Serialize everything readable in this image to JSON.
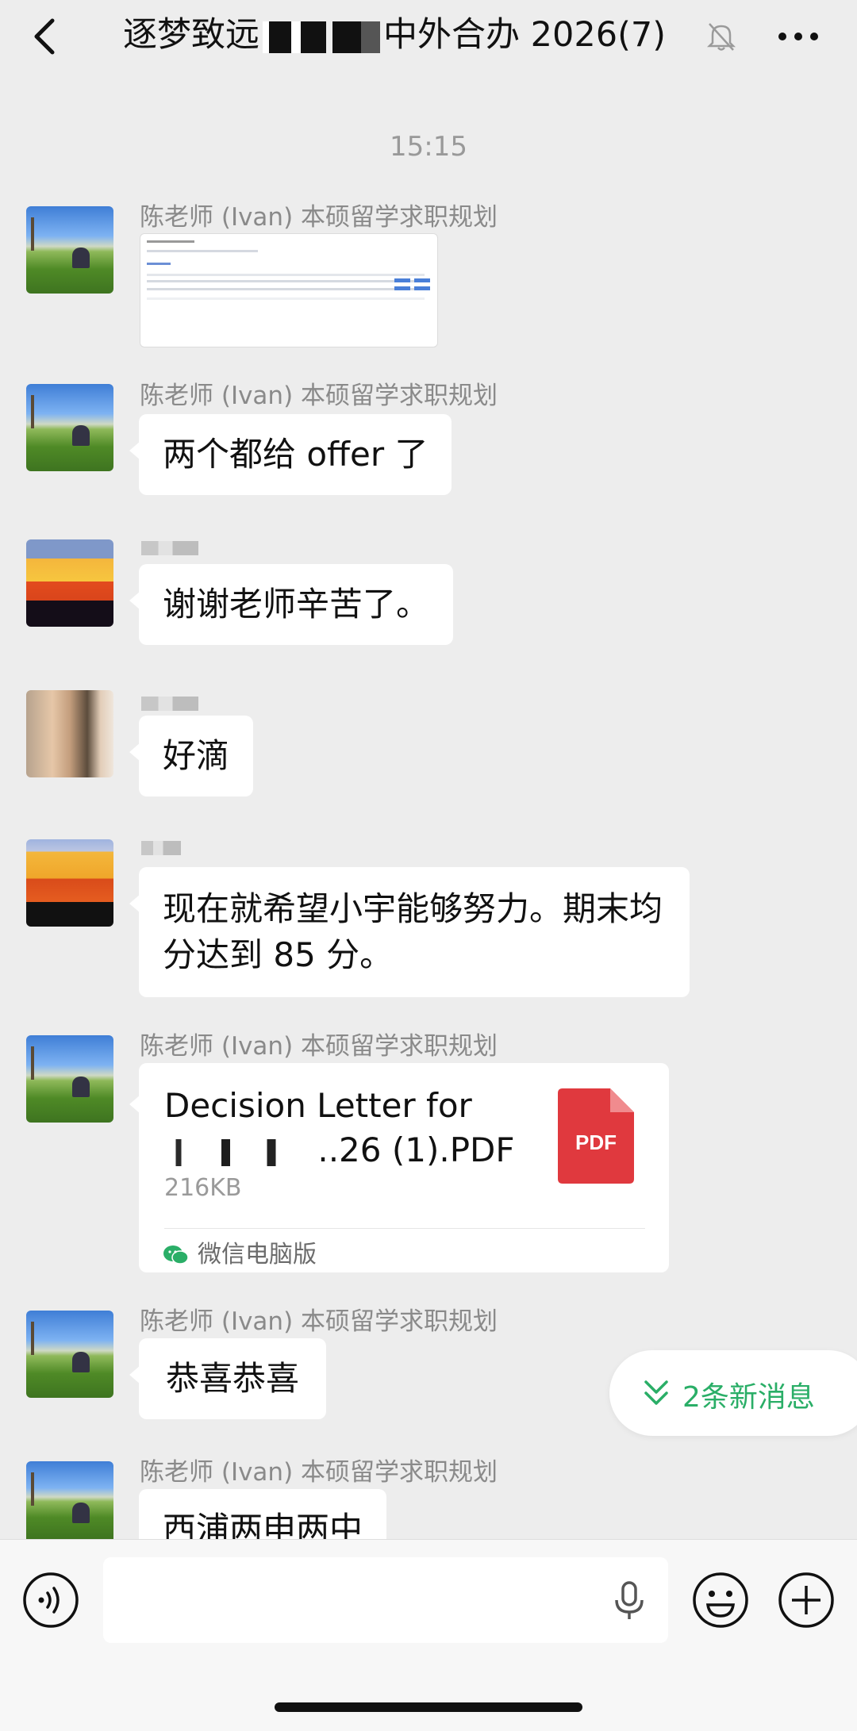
{
  "header": {
    "title_prefix": "逐梦致远",
    "title_suffix": "中外合办 2026(7)"
  },
  "timestamp": "15:15",
  "messages": [
    {
      "sender": "陈老师 (Ivan) 本硕留学求职规划",
      "type": "image"
    },
    {
      "sender": "陈老师 (Ivan) 本硕留学求职规划",
      "text": "两个都给 offer 了"
    },
    {
      "text": "谢谢老师辛苦了。"
    },
    {
      "text": "好滴"
    },
    {
      "text_lines": [
        "现在就希望小宇能够努力。期末均",
        "分达到 85 分。"
      ]
    },
    {
      "sender": "陈老师 (Ivan) 本硕留学求职规划",
      "type": "file",
      "file_name_line1": "Decision Letter for",
      "file_name_line2_suffix": "..26 (1).PDF",
      "file_size": "216KB",
      "file_icon_label": "PDF",
      "file_source": "微信电脑版"
    },
    {
      "sender": "陈老师 (Ivan) 本硕留学求职规划",
      "text": "恭喜恭喜"
    },
    {
      "sender": "陈老师 (Ivan) 本硕留学求职规划",
      "text": "西浦两申两中"
    }
  ],
  "new_messages_label": "2条新消息",
  "colors": {
    "background": "#ededed",
    "bubble": "#ffffff",
    "accent_green": "#2aae67",
    "pdf_red": "#e0393e"
  }
}
